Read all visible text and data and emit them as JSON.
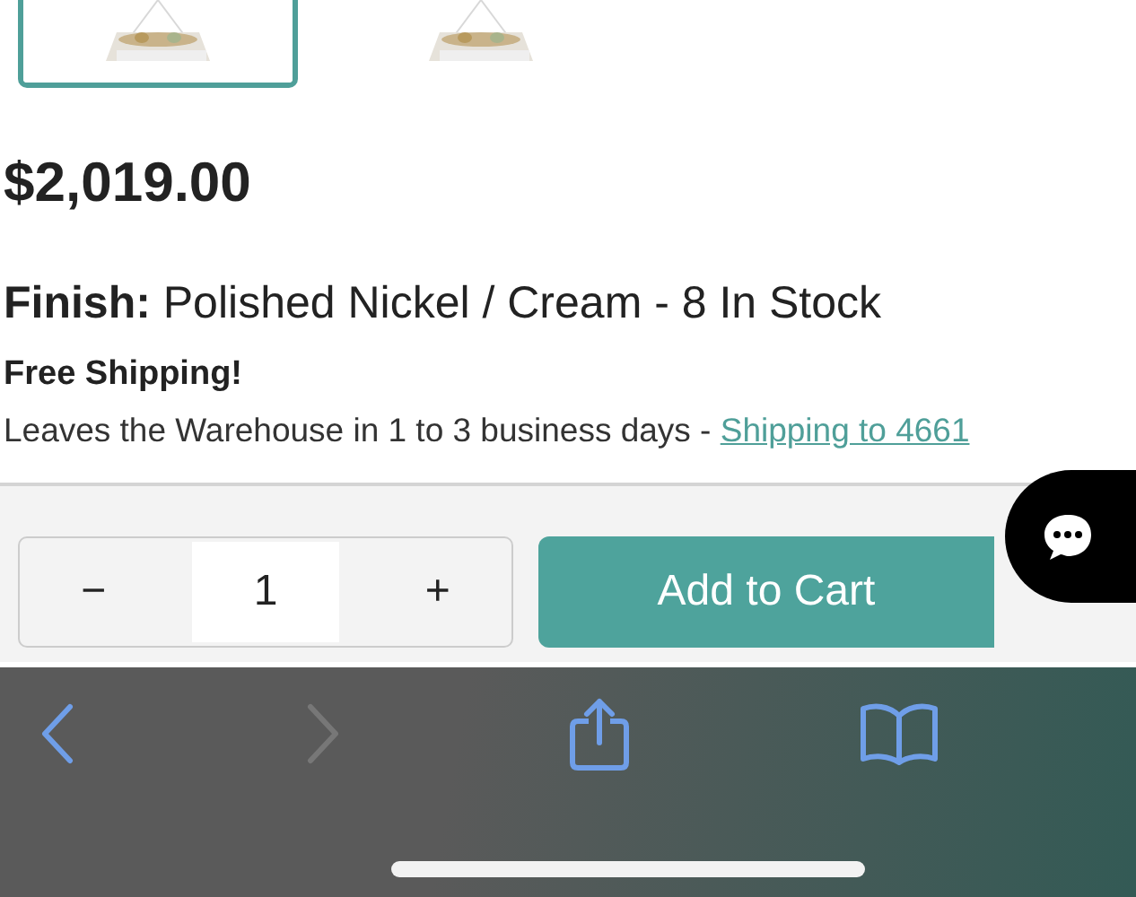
{
  "thumbnails": [
    {
      "kind": "picture",
      "selected": true
    },
    {
      "kind": "picture",
      "selected": false
    }
  ],
  "price": "$2,019.00",
  "finish": {
    "label": "Finish:",
    "value": "Polished Nickel / Cream - 8 In Stock"
  },
  "shipping": {
    "title": "Free Shipping!",
    "text": "Leaves the Warehouse in 1 to 3 business days - ",
    "link": "Shipping to 4661"
  },
  "quantity": {
    "minus": "−",
    "value": "1",
    "plus": "+"
  },
  "add_to_cart": "Add to Cart",
  "toolbar": [
    {
      "kind": "back",
      "disabled": false
    },
    {
      "kind": "forward",
      "disabled": true
    },
    {
      "kind": "share",
      "disabled": false
    },
    {
      "kind": "bookmarks",
      "disabled": false
    }
  ]
}
